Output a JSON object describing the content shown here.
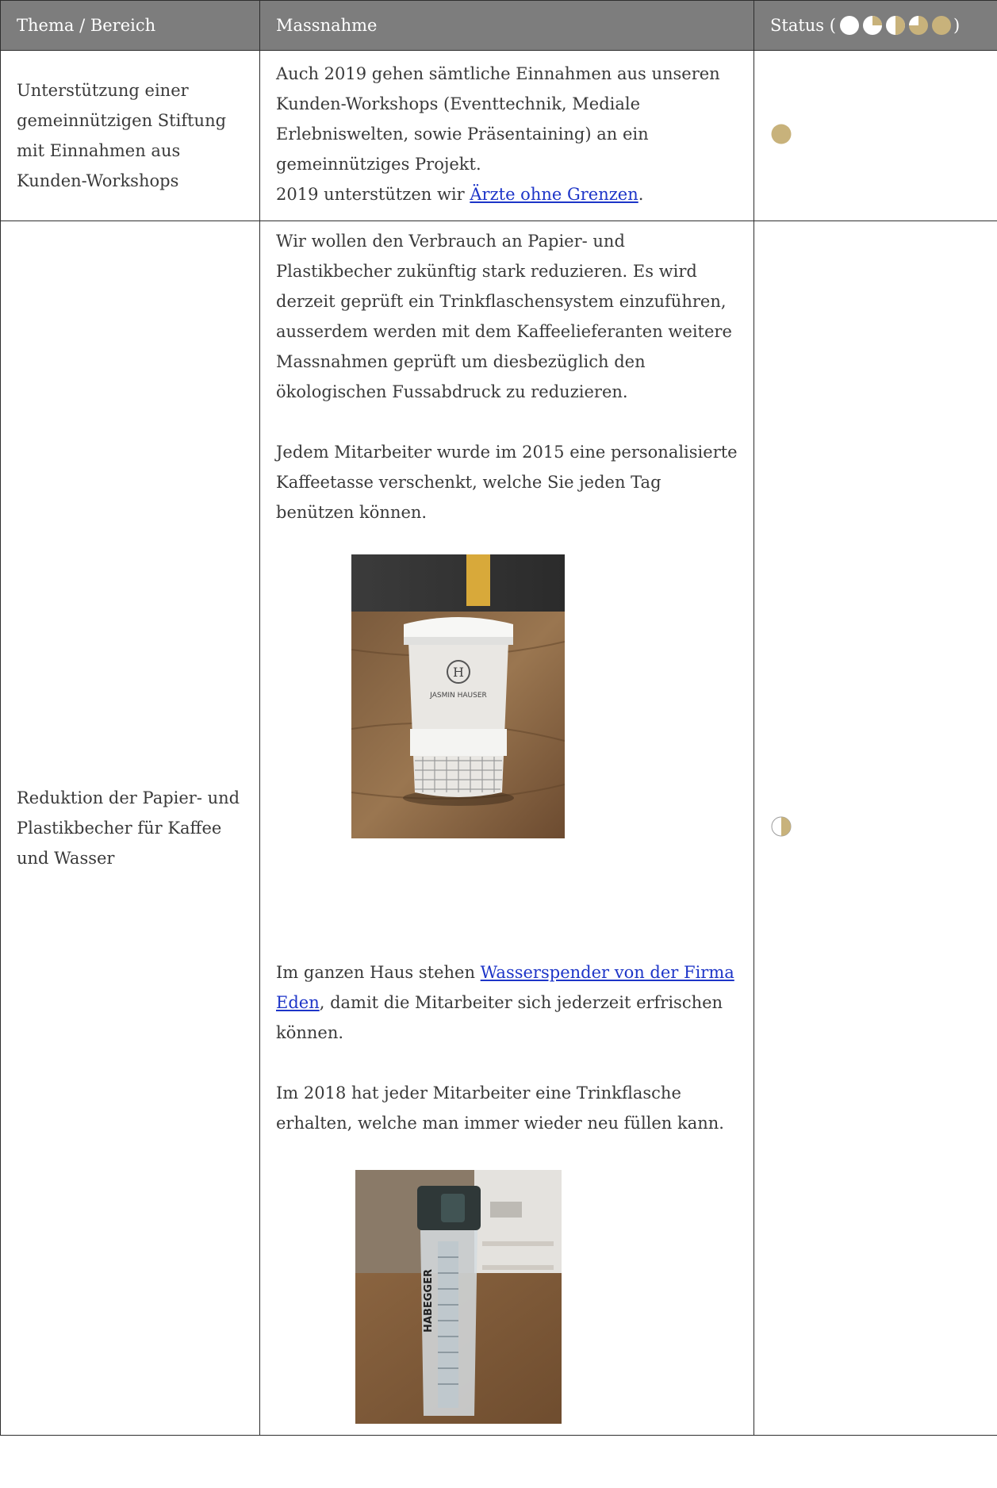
{
  "header": {
    "col_topic": "Thema / Bereich",
    "col_measure": "Massnahme",
    "col_status_prefix": "Status (",
    "col_status_suffix": ")",
    "legend_icons": [
      "status-empty-icon",
      "status-quarter-icon",
      "status-half-icon",
      "status-three-quarter-icon",
      "status-full-icon"
    ]
  },
  "colors": {
    "header_bg": "#7d7d7d",
    "gold": "#c8b27b",
    "link": "#1d35c8",
    "border": "#2e2e2e"
  },
  "rows": [
    {
      "topic": "Unterstützung einer gemeinnützigen Stiftung mit Einnahmen aus Kunden-Workshops",
      "measure_text": "Auch 2019 gehen sämtliche Einnahmen aus unseren Kunden-Workshops (Eventtechnik, Mediale Erlebniswelten, sowie Präsentaining) an ein gemeinnütziges Projekt.",
      "measure_line2_prefix": "2019 unterstützen wir ",
      "measure_link": "Ärzte ohne Grenzen",
      "measure_line2_suffix": ".",
      "status": "full",
      "status_icon": "status-full-icon"
    },
    {
      "topic": "Reduktion der Papier- und Plastikbecher für Kaffee und Wasser",
      "p1": "Wir wollen den Verbrauch an Papier- und Plastikbecher zukünftig stark reduzieren. Es wird derzeit geprüft ein Trinkflaschensystem einzuführen, ausserdem werden mit dem Kaffeelieferanten weitere Massnahmen geprüft um diesbezüglich den ökologischen Fussabdruck zu reduzieren.",
      "p2": "Jedem Mitarbeiter wurde im 2015 eine personalisierte Kaffeetasse verschenkt, welche Sie jeden Tag benützen können.",
      "photo1_cup_text": "JASMIN HAUSER",
      "photo1_logo_letter": "H",
      "p3_prefix": "Im ganzen Haus stehen ",
      "p3_link": "Wasserspender von der Firma Eden",
      "p3_suffix": ", damit die Mitarbeiter sich jederzeit erfrischen können.",
      "p4": "Im 2018 hat jeder Mitarbeiter eine Trinkflasche erhalten, welche man immer wieder neu füllen kann.",
      "photo2_bottle_text": "HABEGGER",
      "status": "half",
      "status_icon": "status-half-icon"
    }
  ]
}
